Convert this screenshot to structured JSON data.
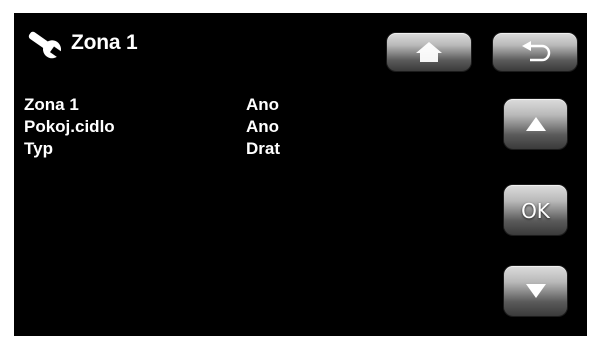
{
  "header": {
    "title": "Zona 1",
    "icon": "wrench-icon"
  },
  "rows": [
    {
      "label": "Zona 1",
      "value": "Ano"
    },
    {
      "label": "Pokoj.cidlo",
      "value": "Ano"
    },
    {
      "label": "Typ",
      "value": "Drat"
    }
  ],
  "buttons": {
    "home_icon": "home-icon",
    "back_icon": "back-arrow-icon",
    "up_icon": "arrow-up-icon",
    "ok_label": "OK",
    "down_icon": "arrow-down-icon"
  },
  "colors": {
    "background": "#000000",
    "text": "#ffffff",
    "button_gray": "#8a8a8a"
  }
}
